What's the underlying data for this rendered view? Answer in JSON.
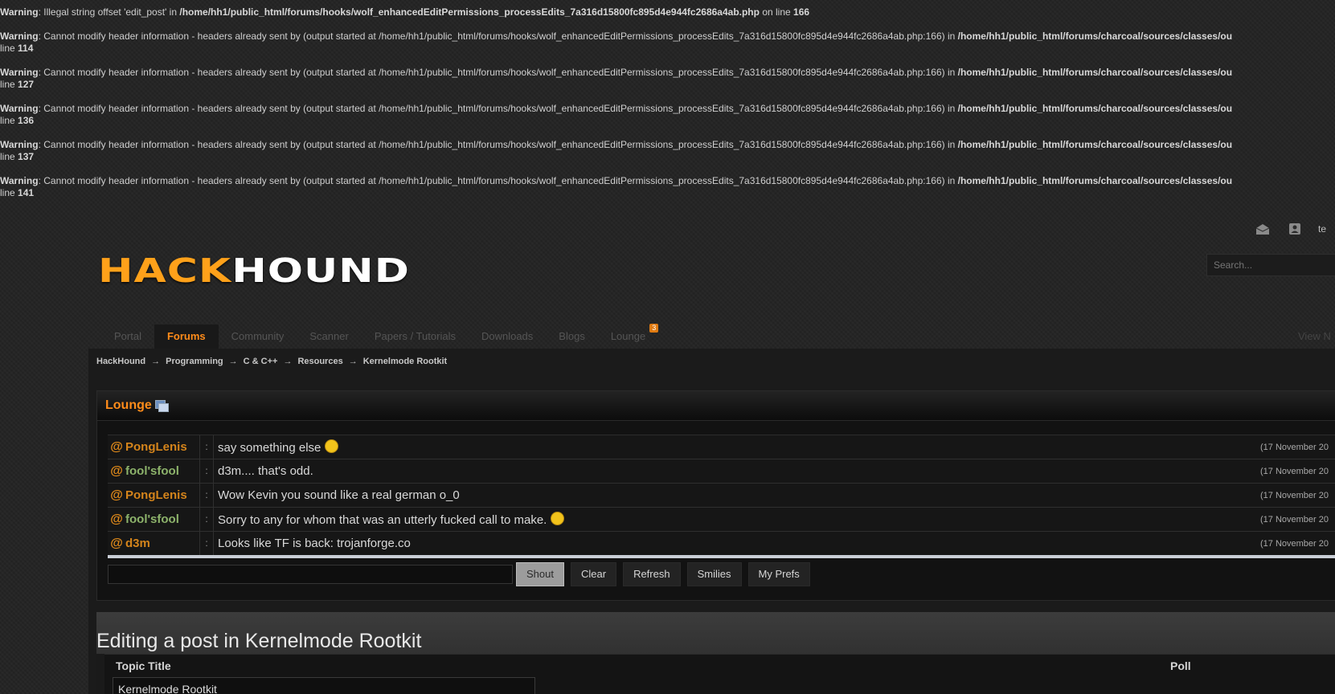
{
  "warnings": [
    {
      "label": "Warning",
      "text": ": Illegal string offset 'edit_post' in ",
      "path": "/home/hh1/public_html/forums/hooks/wolf_enhancedEditPermissions_processEdits_7a316d15800fc895d4e944fc2686a4ab.php",
      "tail": " on line ",
      "line": "166"
    },
    {
      "label": "Warning",
      "text": ": Cannot modify header information - headers already sent by (output started at /home/hh1/public_html/forums/hooks/wolf_enhancedEditPermissions_processEdits_7a316d15800fc895d4e944fc2686a4ab.php:166) in ",
      "path": "/home/hh1/public_html/forums/charcoal/sources/classes/ou",
      "tail": "line ",
      "line": "114"
    },
    {
      "label": "Warning",
      "text": ": Cannot modify header information - headers already sent by (output started at /home/hh1/public_html/forums/hooks/wolf_enhancedEditPermissions_processEdits_7a316d15800fc895d4e944fc2686a4ab.php:166) in ",
      "path": "/home/hh1/public_html/forums/charcoal/sources/classes/ou",
      "tail": "line ",
      "line": "127"
    },
    {
      "label": "Warning",
      "text": ": Cannot modify header information - headers already sent by (output started at /home/hh1/public_html/forums/hooks/wolf_enhancedEditPermissions_processEdits_7a316d15800fc895d4e944fc2686a4ab.php:166) in ",
      "path": "/home/hh1/public_html/forums/charcoal/sources/classes/ou",
      "tail": "line ",
      "line": "136"
    },
    {
      "label": "Warning",
      "text": ": Cannot modify header information - headers already sent by (output started at /home/hh1/public_html/forums/hooks/wolf_enhancedEditPermissions_processEdits_7a316d15800fc895d4e944fc2686a4ab.php:166) in ",
      "path": "/home/hh1/public_html/forums/charcoal/sources/classes/ou",
      "tail": "line ",
      "line": "137"
    },
    {
      "label": "Warning",
      "text": ": Cannot modify header information - headers already sent by (output started at /home/hh1/public_html/forums/hooks/wolf_enhancedEditPermissions_processEdits_7a316d15800fc895d4e944fc2686a4ab.php:166) in ",
      "path": "/home/hh1/public_html/forums/charcoal/sources/classes/ou",
      "tail": "line ",
      "line": "141"
    }
  ],
  "userbar": {
    "messenger_icon": "envelope-icon",
    "notify_icon": "notification-icon",
    "user": "te"
  },
  "logo": {
    "part1": "HACK",
    "part2": "HOUND"
  },
  "search": {
    "placeholder": "Search..."
  },
  "nav": {
    "tabs": [
      "Portal",
      "Forums",
      "Community",
      "Scanner",
      "Papers / Tutorials",
      "Downloads",
      "Blogs",
      "Lounge"
    ],
    "lounge_badge": "3",
    "view_new": "View N"
  },
  "breadcrumb": [
    "HackHound",
    "Programming",
    "C & C++",
    "Resources",
    "Kernelmode Rootkit"
  ],
  "breadcrumb_sep": "→",
  "lounge": {
    "title": "Lounge",
    "shouts": [
      {
        "at": "@",
        "user": "PongLenis",
        "msg": "say something else",
        "time": "(17 November 20"
      },
      {
        "at": "@",
        "user": "fool'sfool",
        "msg": "d3m.... that's odd.",
        "time": "(17 November 20"
      },
      {
        "at": "@",
        "user": "PongLenis",
        "msg": "Wow Kevin you sound like a real german o_0",
        "time": "(17 November 20"
      },
      {
        "at": "@",
        "user": "fool'sfool",
        "msg": "Sorry to any for whom that was an utterly fucked call to make.",
        "time": "(17 November 20"
      },
      {
        "at": "@",
        "user": "d3m",
        "msg": "Looks like TF is back: trojanforge.co",
        "time": "(17 November 20"
      }
    ],
    "buttons": {
      "shout": "Shout",
      "clear": "Clear",
      "refresh": "Refresh",
      "smilies": "Smilies",
      "prefs": "My Prefs"
    }
  },
  "editing": {
    "title": "Editing a post in Kernelmode Rootkit",
    "topic_title_label": "Topic Title",
    "topic_title_value": "Kernelmode Rootkit",
    "poll_label": "Poll"
  },
  "colors": {
    "accent": "#ff8c1a",
    "user_orange": "#d4841b",
    "user_green": "#8db36b"
  }
}
